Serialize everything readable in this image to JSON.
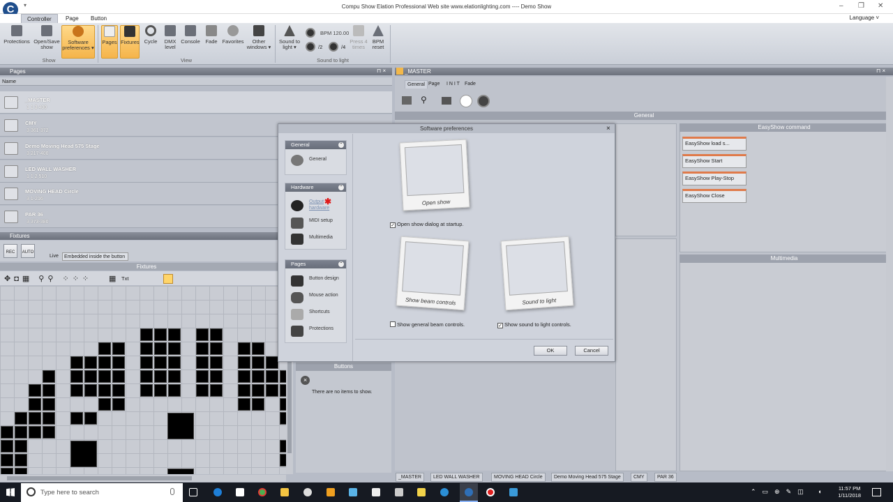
{
  "titlebar": {
    "title": "Compu Show   Elation Professional   Web site  www.elationlighting.com ---- Demo Show",
    "quick_access": "▾"
  },
  "tabs": {
    "controller": "Controller",
    "page": "Page",
    "button": "Button",
    "language": "Language ˅"
  },
  "ribbon": {
    "protections": "Protections",
    "open_save_1": "Open/Save",
    "open_save_2": "show",
    "soft_pref_1": "Software",
    "soft_pref_2": "preferences ▾",
    "group_show": "Show",
    "pages": "Pages",
    "fixtures": "Fixtures",
    "cycle": "Cycle",
    "dmx_1": "DMX",
    "dmx_2": "level",
    "console": "Console",
    "fade": "Fade",
    "favorites": "Favorites",
    "other_1": "Other",
    "other_2": "windows ▾",
    "group_view": "View",
    "sound_1": "Sound to",
    "sound_2": "light ▾",
    "bpm": "BPM 120.00",
    "div2": "/2",
    "div4": "/4",
    "press_1": "Press 4",
    "press_2": "times",
    "bpm_reset_1": "BPM",
    "bpm_reset_2": "reset",
    "group_sound": "Sound to light"
  },
  "pages_panel": {
    "title": "Pages",
    "col_name": "Name",
    "rows": [
      {
        "name": "_MASTER",
        "info": "1   1   3   400"
      },
      {
        "name": "CMY",
        "info": "3   361-372"
      },
      {
        "name": "Demo Moving Head 575 Stage",
        "info": "3   217-400"
      },
      {
        "name": "LED WALL WASHER",
        "info": "1   1   2   510"
      },
      {
        "name": "MOVING HEAD Circle",
        "info": "3   1-216"
      },
      {
        "name": "PAR 36",
        "info": "3   373-380"
      }
    ]
  },
  "fixtures_panel": {
    "title": "Fixtures",
    "rec": "REC",
    "auto": "AUTO",
    "live": "Live",
    "embedded": "Embedded inside the button",
    "header": "Fixtures",
    "txt": "Txt"
  },
  "buttons_panel": {
    "title": "Buttons",
    "empty": "There are no items to show."
  },
  "master_panel": {
    "title": "_MASTER",
    "tab_general": "General",
    "tab_page": "Page",
    "tab_init": "I N I T",
    "tab_fade": "Fade",
    "general_hdr": "General",
    "easyshow_hdr": "EasyShow command",
    "multimedia_hdr": "Multimedia",
    "easyshow": [
      "EasyShow load s...",
      "EasyShow Start",
      "EasyShow Play-Stop",
      "EasyShow Close"
    ]
  },
  "dialog": {
    "title": "Software preferences",
    "close": "×",
    "sec_general": "General",
    "item_general": "General",
    "sec_hardware": "Hardware",
    "item_output_1": "Output",
    "item_output_2": "hardware",
    "item_midi": "MIDI setup",
    "item_multimedia": "Multimedia",
    "sec_pages": "Pages",
    "item_button_design": "Button design",
    "item_mouse": "Mouse action",
    "item_shortcuts": "Shortcuts",
    "item_protections": "Protections",
    "cap_open": "Open show",
    "cap_beam": "Show beam controls",
    "cap_sound": "Sound to light",
    "chk_open": "Open show dialog at startup.",
    "chk_beam": "Show general beam controls.",
    "chk_sound": "Show sound to light controls.",
    "check_open": "✓",
    "check_beam": "",
    "check_sound": "✓",
    "ok": "OK",
    "cancel": "Cancel"
  },
  "bottom_tabs": [
    "_MASTER",
    "LED WALL WASHER",
    "MOVING HEAD Circle",
    "Demo Moving Head 575 Stage",
    "CMY",
    "PAR 36"
  ],
  "taskbar": {
    "search": "Type here to search",
    "time": "11:57 PM",
    "date": "1/11/2018"
  }
}
